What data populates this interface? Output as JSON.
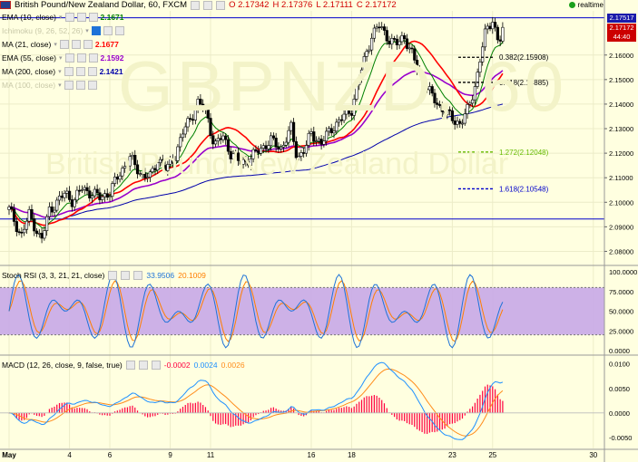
{
  "header": {
    "title": "British Pound/New Zealand Dollar, 60, FXCM",
    "open": "O 2.17342",
    "high": "H 2.17376",
    "low": "L 2.17111",
    "close": "C 2.17172",
    "realtime_label": "realtime"
  },
  "watermark": {
    "symbol": "GBPNZD, 60",
    "description": "British Pound/New Zealand Dollar"
  },
  "indicators": [
    {
      "name": "EMA (10, close)",
      "value": "2.1671",
      "color": "#008000",
      "faded": false
    },
    {
      "name": "Ichimoku (9, 26, 52, 26)",
      "value": "",
      "color": "#7f7fff",
      "faded": true
    },
    {
      "name": "MA (21, close)",
      "value": "2.1677",
      "color": "#ff0000",
      "faded": false
    },
    {
      "name": "EMA (55, close)",
      "value": "2.1592",
      "color": "#9900cc",
      "faded": false
    },
    {
      "name": "MA (200, close)",
      "value": "2.1421",
      "color": "#0000aa",
      "faded": false
    },
    {
      "name": "MA (100, close)",
      "value": "",
      "color": "#c8c8a8",
      "faded": true
    }
  ],
  "price_tags": {
    "high_tag": "2.17517",
    "last_tag": "2.17172",
    "countdown": "44:40",
    "high_tag_color": "#1a1aaa",
    "last_tag_color": "#cc0000"
  },
  "fib_levels": [
    {
      "label": "0.382(2.15908)",
      "value": 2.15908,
      "color": "#000000"
    },
    {
      "label": "0.618(2.14885)",
      "value": 2.14885,
      "color": "#000000"
    },
    {
      "label": "1.272(2.12048)",
      "value": 2.12048,
      "color": "#66bb00"
    },
    {
      "label": "1.618(2.10548)",
      "value": 2.10548,
      "color": "#0000cc"
    }
  ],
  "horizontal_lines": [
    {
      "value": 2.0932,
      "color": "#0000cc"
    },
    {
      "value": 2.17517,
      "color": "#0000cc"
    }
  ],
  "stoch": {
    "legend": "Stoch RSI (3, 3, 21, 21, close)",
    "k_value": "33.9506",
    "d_value": "20.1009",
    "k_color": "#1e73d8",
    "d_color": "#ff7f00",
    "band_color": "#c8a8e8",
    "ticks": [
      "100.0000",
      "75.0000",
      "50.0000",
      "25.0000",
      "0.0000"
    ]
  },
  "macd": {
    "legend": "MACD (12, 26, close, 9, false, true)",
    "hist_value": "-0.0002",
    "macd_value": "0.0024",
    "signal_value": "0.0026",
    "hist_color": "#ff0040",
    "macd_color": "#1e90ff",
    "signal_color": "#ff8c1a",
    "ticks": [
      "0.0100",
      "0.0050",
      "0.0000",
      "-0.0050"
    ]
  },
  "chart_data": {
    "type": "candlestick",
    "symbol": "GBPNZD",
    "timeframe": "60",
    "y_ticks": [
      2.16,
      2.15,
      2.14,
      2.13,
      2.12,
      2.11,
      2.1,
      2.09,
      2.08
    ],
    "y_tick_labels": [
      "2.16000",
      "2.15000",
      "2.14000",
      "2.13000",
      "2.12000",
      "2.11000",
      "2.10000",
      "2.09000",
      "2.08000"
    ],
    "ylim": [
      2.075,
      2.178
    ],
    "x_labels": [
      "May",
      "4",
      "6",
      "9",
      "11",
      "16",
      "18",
      "23",
      "25",
      "30"
    ],
    "x_label_days": [
      1,
      4,
      6,
      9,
      11,
      16,
      18,
      23,
      25,
      30
    ],
    "xlim_days": [
      1,
      31
    ],
    "grid": true,
    "approx_close_path": [
      [
        1.0,
        2.097
      ],
      [
        1.3,
        2.092
      ],
      [
        1.6,
        2.086
      ],
      [
        2.0,
        2.095
      ],
      [
        2.3,
        2.09
      ],
      [
        2.6,
        2.084
      ],
      [
        3.0,
        2.097
      ],
      [
        3.4,
        2.1
      ],
      [
        3.8,
        2.104
      ],
      [
        4.2,
        2.1
      ],
      [
        4.6,
        2.106
      ],
      [
        5.0,
        2.104
      ],
      [
        5.5,
        2.102
      ],
      [
        6.0,
        2.104
      ],
      [
        6.5,
        2.112
      ],
      [
        7.0,
        2.118
      ],
      [
        7.5,
        2.112
      ],
      [
        8.0,
        2.11
      ],
      [
        8.4,
        2.118
      ],
      [
        8.8,
        2.113
      ],
      [
        9.2,
        2.118
      ],
      [
        9.6,
        2.128
      ],
      [
        10.0,
        2.134
      ],
      [
        10.4,
        2.141
      ],
      [
        10.8,
        2.136
      ],
      [
        11.2,
        2.123
      ],
      [
        11.6,
        2.127
      ],
      [
        12.0,
        2.12
      ],
      [
        12.5,
        2.116
      ],
      [
        13.0,
        2.118
      ],
      [
        13.5,
        2.122
      ],
      [
        14.0,
        2.125
      ],
      [
        14.5,
        2.122
      ],
      [
        15.0,
        2.13
      ],
      [
        15.3,
        2.118
      ],
      [
        15.7,
        2.122
      ],
      [
        16.0,
        2.128
      ],
      [
        16.5,
        2.124
      ],
      [
        17.0,
        2.13
      ],
      [
        17.5,
        2.134
      ],
      [
        18.0,
        2.138
      ],
      [
        18.3,
        2.148
      ],
      [
        18.7,
        2.16
      ],
      [
        19.0,
        2.168
      ],
      [
        19.4,
        2.172
      ],
      [
        19.8,
        2.167
      ],
      [
        20.2,
        2.164
      ],
      [
        20.6,
        2.168
      ],
      [
        21.0,
        2.16
      ],
      [
        21.5,
        2.15
      ],
      [
        22.0,
        2.143
      ],
      [
        22.5,
        2.138
      ],
      [
        23.0,
        2.134
      ],
      [
        23.4,
        2.132
      ],
      [
        23.8,
        2.138
      ],
      [
        24.2,
        2.15
      ],
      [
        24.6,
        2.168
      ],
      [
        25.0,
        2.175
      ],
      [
        25.3,
        2.164
      ],
      [
        25.6,
        2.173
      ]
    ]
  }
}
